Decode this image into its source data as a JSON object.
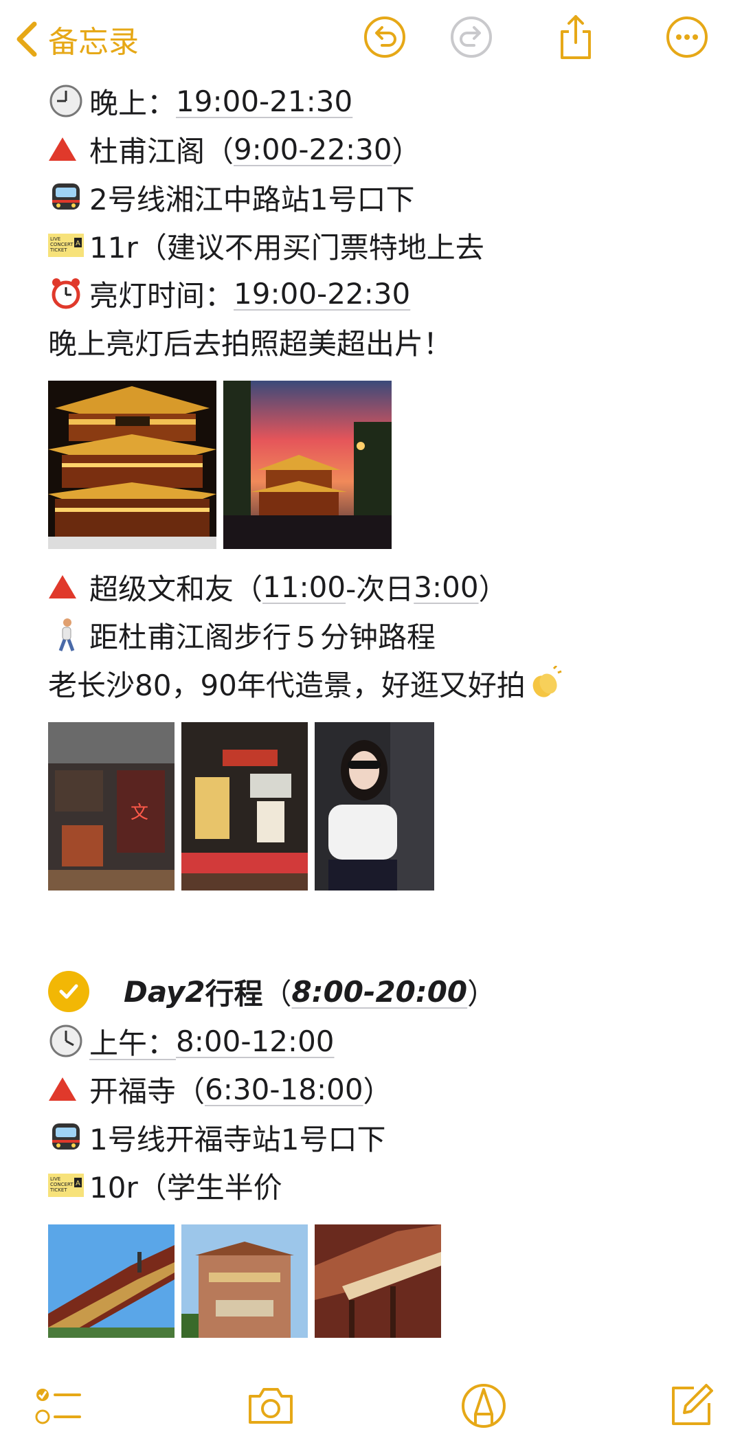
{
  "nav": {
    "back_label": "备忘录"
  },
  "lines": {
    "l1_prefix": "晚上：",
    "l1_time": "19:00-21:30",
    "l2_name": "杜甫江阁",
    "l2_open": "（",
    "l2_time": "9:00-22:30",
    "l2_close": "）",
    "l3": "2号线湘江中路站1号口下",
    "l4": "11r（建议不用买门票特地上去",
    "l5_prefix": "亮灯时间：",
    "l5_time": "19:00-22:30",
    "l6": "晚上亮灯后去拍照超美超出片！",
    "l7_name": "超级文和友",
    "l7_open": "（",
    "l7_t1": "11:00",
    "l7_mid": "-次日",
    "l7_t2": "3:00",
    "l7_close": "）",
    "l8": "距杜甫江阁步行５分钟路程",
    "l9": "老长沙80，90年代造景，好逛又好拍",
    "day_title": "Day2",
    "day_title_cn": "行程",
    "day_open": "（",
    "day_time": "8:00-20:00",
    "day_close": "）",
    "l10_prefix": "上午：",
    "l10_time": "8:00-12:00",
    "l11_name": "开福寺",
    "l11_open": "（",
    "l11_time": "6:30-18:00",
    "l11_close": "）",
    "l12": "1号线开福寺站1号口下",
    "l13": "10r（学生半价"
  },
  "ticket_icon": {
    "t1": "LIVE",
    "t2": "CONCERT",
    "t3": "TICKET",
    "t4": "A"
  },
  "icons": [
    "back-chevron-icon",
    "undo-icon",
    "redo-icon",
    "share-icon",
    "more-icon",
    "clock-icon",
    "red-triangle-icon",
    "train-icon",
    "ticket-icon",
    "alarm-clock-icon",
    "walking-person-icon",
    "clapping-hands-icon",
    "checkmark-icon",
    "checklist-icon",
    "camera-icon",
    "markup-icon",
    "compose-icon"
  ],
  "colors": {
    "accent": "#e6a817",
    "red": "#e0392b",
    "check": "#f2b705"
  }
}
